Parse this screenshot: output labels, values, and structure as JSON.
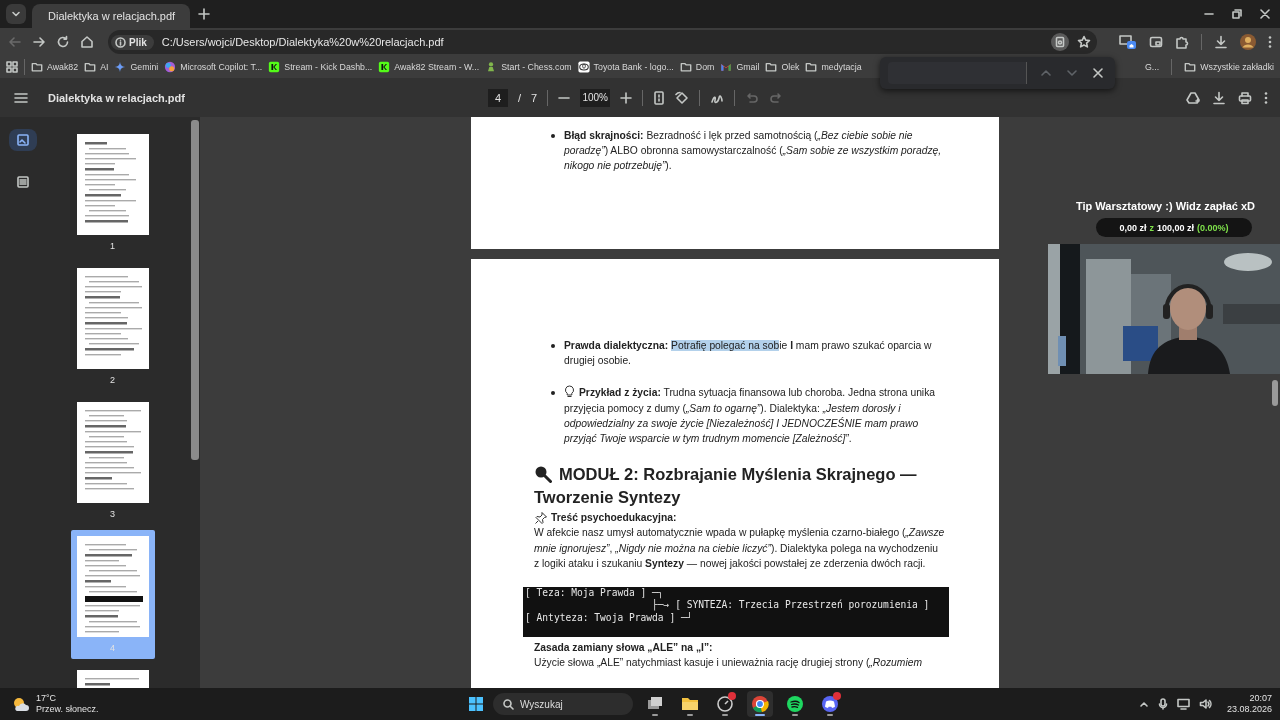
{
  "tabs": [
    {
      "title": "Dialektyka w relacjach.pdf",
      "selected": true
    }
  ],
  "nav_buttons": [
    {
      "kind": "back",
      "disabled": true
    },
    {
      "kind": "forward",
      "disabled": false
    },
    {
      "kind": "reload",
      "disabled": false
    },
    {
      "kind": "home",
      "disabled": false
    }
  ],
  "address_bar": {
    "chip": "Plik",
    "url": "C:/Users/wojci/Desktop/Dialektyka%20w%20relacjach.pdf"
  },
  "bookmarks": [
    {
      "label": "Awak82",
      "kind": "folder"
    },
    {
      "label": "AI",
      "kind": "folder"
    },
    {
      "label": "Gemini",
      "kind": "gemini"
    },
    {
      "label": "Microsoft Copilot: T...",
      "kind": "copilot"
    },
    {
      "label": "Stream - Kick Dashb...",
      "kind": "kick"
    },
    {
      "label": "Awak82 Stream - W...",
      "kind": "kick"
    },
    {
      "label": "Start - Chess.com",
      "kind": "chess"
    },
    {
      "label": "Toyota Bank - logo...",
      "kind": "toyota"
    },
    {
      "label": "Dom",
      "kind": "folder"
    },
    {
      "label": "Gmail",
      "kind": "gmail"
    },
    {
      "label": "Olek",
      "kind": "folder"
    },
    {
      "label": "medytacja",
      "kind": "folder"
    }
  ],
  "bookmarks_right": [
    {
      "label": "G..."
    },
    {
      "label": "Wszystkie zakładki",
      "kind": "folder"
    }
  ],
  "find_bar": {
    "buttons": [
      {
        "kind": "up",
        "disabled": true
      },
      {
        "kind": "down",
        "disabled": true
      },
      {
        "kind": "close",
        "disabled": false
      }
    ]
  },
  "pdf_toolbar": {
    "title": "Dialektyka w relacjach.pdf",
    "page": "4",
    "separator": "/",
    "page_total": "7",
    "zoom": "100%",
    "tools": [
      {
        "kind": "undo",
        "disabled": true
      },
      {
        "kind": "redo",
        "disabled": true
      }
    ]
  },
  "sidebar": {
    "views": [
      {
        "kind": "thumbnails",
        "selected": true
      },
      {
        "kind": "outline",
        "selected": false
      }
    ],
    "thumbnails": [
      {
        "label": "1",
        "selected": false
      },
      {
        "label": "2",
        "selected": false
      },
      {
        "label": "3",
        "selected": false
      },
      {
        "label": "4",
        "selected": true
      },
      {
        "selected": false
      }
    ]
  },
  "document": {
    "pages": [
      {
        "blocks": [
          {
            "kind": "bullet",
            "text": "**Błąd skrajności:** Bezradność i lęk przed samotnością (*„Bez ciebie sobie nie poradzę”*) ALBO obronna samowystarczalność (*„Sam sobie ze wszystkim poradzę, nikogo nie potrzebuję”*)."
          }
        ]
      },
      {
        "blocks": [
          {
            "kind": "bullet",
            "runs": [
              {
                "text": "**Prawda dialektyczna:** ",
                "selected": false
              },
              {
                "text": "Potrafię polegać na sob",
                "selected": true
              },
              {
                "text": "ie **I** mam prawo szukać oparcia w drugiej osobie.",
                "selected": false
              }
            ]
          },
          {
            "kind": "tip_bullet",
            "text": "**Przykład z życia:** Trudna sytuacja finansowa lub choroba. Jedna strona unika przyjęcia pomocy z dumy (*„Sam to ogarnę”*). Dialektyka: *„Jestem dorosły i odpowiedzialny za swoje życie [Niezależność] I JEDNOCZEŚNIE mam prawo przyjąć Twoje wsparcie w tym trudnym momencie [Zależność]”*."
          },
          {
            "kind": "module_heading",
            "text": "MODUŁ 2: Rozbrajanie Myślenia Skrajnego — Tworzenie Syntezy"
          },
          {
            "kind": "pinned_label",
            "text": "Treść psychoedukacyjna:"
          },
          {
            "kind": "paragraph",
            "text": "W afekcie nasz umysł automatycznie wpada w pułapkę myślenia czarno-białego (*„Zawsze mnie ignorujesz”*, *„Nigdy nie można na ciebie liczyć”*). Dialektyka polega na wychodzeniu z logiki ataku i szukaniu **Syntezy** — nowej jakości powstałej ze zderzenia dwóch racji."
          },
          {
            "kind": "code",
            "lines": [
              "[ Teza: Moja Prawda ] ─┐",
              "                      ├─→ [ SYNTEZA: Trzecia Przestrzeń porozumienia ]",
              "[ Antyteza: Twoja Prawda ] ─┘"
            ]
          },
          {
            "kind": "bold_heading",
            "text": "Zasada zamiany słowa „ALE” na „I”:"
          },
          {
            "kind": "paragraph",
            "text": "Użycie słowa „ALE” natychmiast kasuje i unieważnia rację drugiej strony (*„Rozumiem*"
          }
        ]
      }
    ]
  },
  "stream_overlay": {
    "title": "Tip Warsztatowy :) Widz zapłać xD",
    "progress": [
      {
        "text": "0,00 zł",
        "color": "#ffffff"
      },
      {
        "text": "z",
        "color": "#7ee04a"
      },
      {
        "text": "100,00 zł",
        "color": "#ffffff"
      },
      {
        "text": "(0.00%)",
        "color": "#7ee04a"
      }
    ]
  },
  "taskbar": {
    "temperature": "17°C",
    "weather": "Przew. słonecz.",
    "search_placeholder": "Wyszukaj",
    "apps": [
      {
        "kind": "task_view",
        "active": false,
        "badge": false
      },
      {
        "kind": "explorer",
        "active": false,
        "badge": false
      },
      {
        "kind": "capture",
        "active": false,
        "badge": true
      },
      {
        "kind": "chrome",
        "active": true,
        "badge": false
      },
      {
        "kind": "spotify",
        "active": false,
        "badge": false
      },
      {
        "kind": "discord",
        "active": false,
        "badge": true
      }
    ],
    "time": "20:07",
    "date": "23.08.2026"
  }
}
